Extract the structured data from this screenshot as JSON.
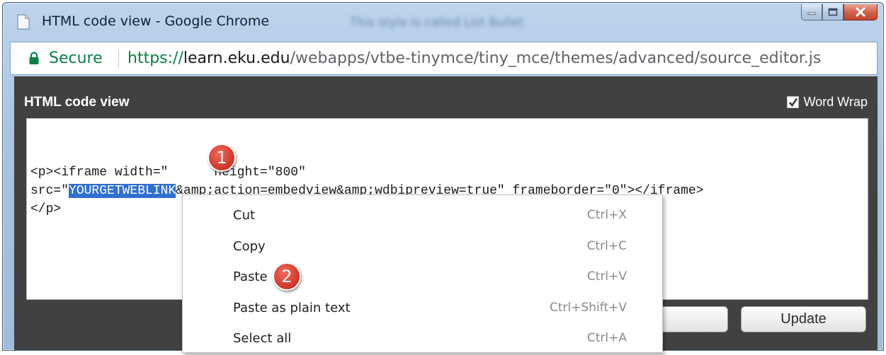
{
  "window": {
    "title": "HTML code view - Google Chrome",
    "background_tab_title": "This style is called List Bullet"
  },
  "address_bar": {
    "security_label": "Secure",
    "url_scheme": "https://",
    "url_host": "learn.eku.edu",
    "url_path": "/webapps/vtbe-tinymce/tiny_mce/themes/advanced/source_editor.js"
  },
  "dialog": {
    "title": "HTML code view",
    "word_wrap_label": "Word Wrap",
    "word_wrap_checked": true,
    "code": {
      "line1_before": "<p><iframe width=\"",
      "line1_gap": "      ",
      "line1_after": "height=\"800\"",
      "line2_prefix": "src=\"",
      "line2_selected": "YOURGETWEBLINK",
      "line2_suffix": "&amp;action=embedview&amp;wdbipreview=true\" frameborder=\"0\"></iframe>",
      "line3": "</p>"
    },
    "cancel_label_visible": "ncel",
    "update_label": "Update"
  },
  "context_menu": {
    "items": [
      {
        "label": "Cut",
        "shortcut": "Ctrl+X"
      },
      {
        "label": "Copy",
        "shortcut": "Ctrl+C"
      },
      {
        "label": "Paste",
        "shortcut": "Ctrl+V"
      },
      {
        "label": "Paste as plain text",
        "shortcut": "Ctrl+Shift+V"
      },
      {
        "label": "Select all",
        "shortcut": "Ctrl+A"
      }
    ]
  },
  "callouts": [
    "1",
    "2"
  ],
  "colors": {
    "secure_green": "#0b8043",
    "selection_blue": "#2f6fd0",
    "dialog_bg": "#414141",
    "callout_red": "#d63b2f"
  }
}
